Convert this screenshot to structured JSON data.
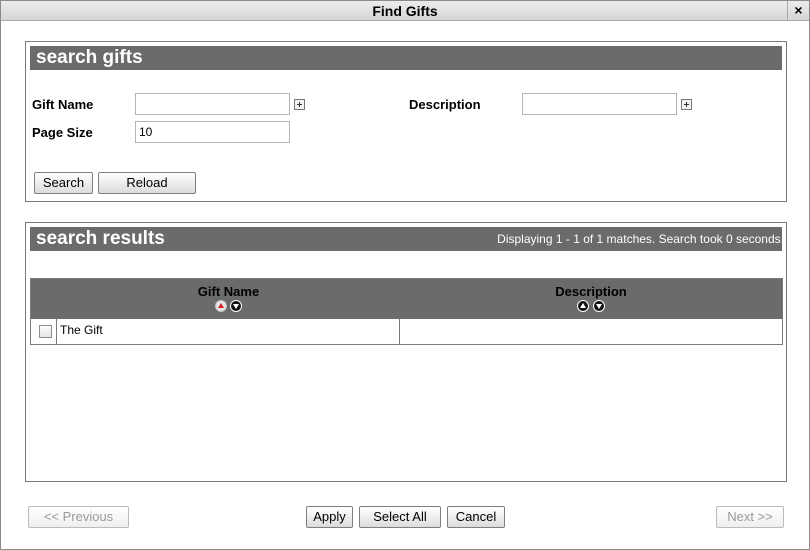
{
  "window": {
    "title": "Find Gifts",
    "close_label": "×"
  },
  "search_panel": {
    "title": "search gifts",
    "gift_name_label": "Gift Name",
    "gift_name_value": "",
    "description_label": "Description",
    "description_value": "",
    "page_size_label": "Page Size",
    "page_size_value": "10",
    "search_button": "Search",
    "reload_button": "Reload"
  },
  "results_panel": {
    "title": "search results",
    "status": "Displaying 1 - 1 of 1 matches. Search took 0 seconds.",
    "columns": [
      "Gift Name",
      "Description"
    ],
    "rows": [
      {
        "gift_name": "The Gift",
        "description": "",
        "checked": false
      }
    ]
  },
  "footer": {
    "previous_button": "<< Previous",
    "apply_button": "Apply",
    "select_all_button": "Select All",
    "cancel_button": "Cancel",
    "next_button": "Next >>"
  },
  "icons": {
    "add_criteria": "plus-box-icon",
    "sort_ascending": "sort-up-icon",
    "sort_descending": "sort-down-icon"
  },
  "colors": {
    "header_bar": "#6b6b6b",
    "header_text": "#ffffff",
    "active_sort_arrow": "#dd2222"
  }
}
